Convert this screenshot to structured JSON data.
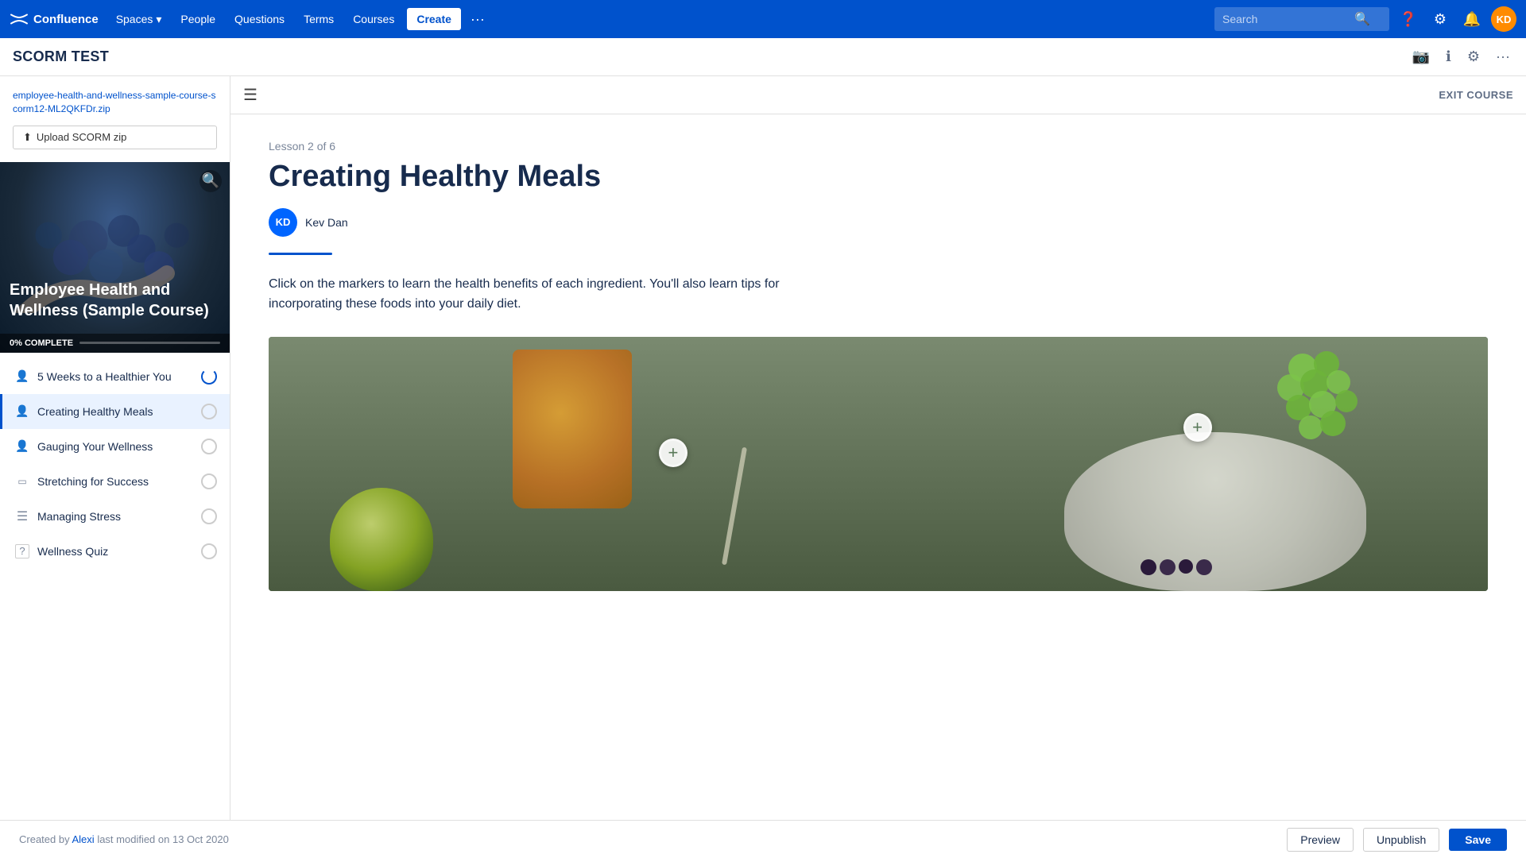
{
  "nav": {
    "logo_text": "Confluence",
    "spaces_label": "Spaces",
    "people_label": "People",
    "questions_label": "Questions",
    "terms_label": "Terms",
    "courses_label": "Courses",
    "create_label": "Create",
    "more_label": "···",
    "search_placeholder": "Search"
  },
  "page_header": {
    "title": "SCORM TEST"
  },
  "sidebar": {
    "file_link": "employee-health-and-wellness-sample-course-scorm12-ML2QKFDr.zip",
    "upload_btn": "Upload SCORM zip",
    "course_card_title": "Employee Health and Wellness (Sample Course)",
    "progress_text": "0% COMPLETE",
    "progress_value": 0
  },
  "lessons": [
    {
      "id": 1,
      "label": "5 Weeks to a Healthier You",
      "icon": "👤",
      "status": "loading",
      "active": false
    },
    {
      "id": 2,
      "label": "Creating Healthy Meals",
      "icon": "👤",
      "status": "empty",
      "active": true
    },
    {
      "id": 3,
      "label": "Gauging Your Wellness",
      "icon": "👤",
      "status": "empty",
      "active": false
    },
    {
      "id": 4,
      "label": "Stretching for Success",
      "icon": "📄",
      "status": "empty",
      "active": false
    },
    {
      "id": 5,
      "label": "Managing Stress",
      "icon": "☰",
      "status": "empty",
      "active": false
    },
    {
      "id": 6,
      "label": "Wellness Quiz",
      "icon": "?",
      "status": "empty",
      "active": false
    }
  ],
  "scorm_viewer": {
    "exit_course_label": "EXIT COURSE",
    "lesson_meta": "Lesson 2 of 6",
    "lesson_title": "Creating Healthy Meals",
    "author_initials": "KD",
    "author_name": "Kev Dan",
    "description": "Click on the markers to learn the health benefits of each ingredient. You'll also learn tips for incorporating these foods into your daily diet."
  },
  "bottom_bar": {
    "created_text": "Created by",
    "author_link": "Alexi",
    "modified_text": "last modified on 13 Oct 2020",
    "preview_label": "Preview",
    "unpublish_label": "Unpublish",
    "save_label": "Save"
  }
}
